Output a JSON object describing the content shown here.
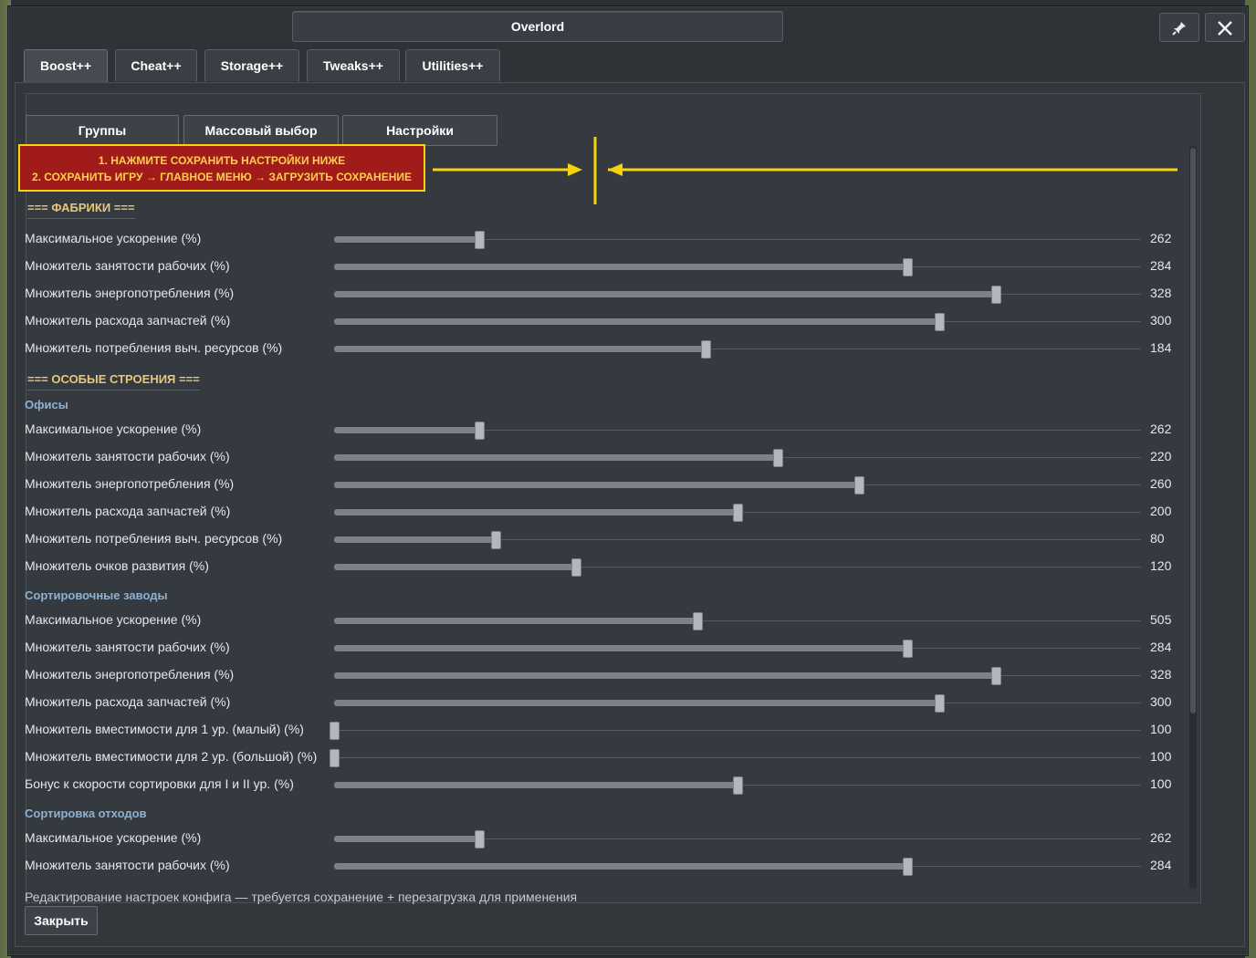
{
  "window": {
    "title": "Overlord",
    "pin_icon": "pin-icon",
    "close_icon": "close-icon"
  },
  "tabs": [
    {
      "label": "Boost++",
      "active": true
    },
    {
      "label": "Cheat++"
    },
    {
      "label": "Storage++"
    },
    {
      "label": "Tweaks++"
    },
    {
      "label": "Utilities++"
    }
  ],
  "subtabs": [
    "Группы",
    "Массовый выбор",
    "Настройки"
  ],
  "notice": {
    "line1": "1. НАЖМИТЕ СОХРАНИТЬ НАСТРОЙКИ НИЖЕ",
    "line2": "2. СОХРАНИТЬ ИГРУ → ГЛАВНОЕ МЕНЮ → ЗАГРУЗИТЬ СОХРАНЕНИЕ",
    "border_color": "#f5d40b",
    "bg_color": "#a11b1b"
  },
  "sections": {
    "factories": "=== ФАБРИКИ ===",
    "special": "=== ОСОБЫЕ СТРОЕНИЯ ==="
  },
  "groups": {
    "offices": "Офисы",
    "sorting": "Сортировочные заводы",
    "waste": "Сортировка отходов"
  },
  "sliders": {
    "factories": [
      {
        "label": "Максимальное ускорение (%)",
        "value": "262",
        "level": 0.18
      },
      {
        "label": "Множитель занятости рабочих (%)",
        "value": "284",
        "level": 0.71
      },
      {
        "label": "Множитель энергопотребления (%)",
        "value": "328",
        "level": 0.82
      },
      {
        "label": "Множитель расхода запчастей (%)",
        "value": "300",
        "level": 0.75
      },
      {
        "label": "Множитель потребления выч. ресурсов (%)",
        "value": "184",
        "level": 0.46
      }
    ],
    "offices": [
      {
        "label": "Максимальное ускорение (%)",
        "value": "262",
        "level": 0.18
      },
      {
        "label": "Множитель занятости рабочих (%)",
        "value": "220",
        "level": 0.55
      },
      {
        "label": "Множитель энергопотребления (%)",
        "value": "260",
        "level": 0.65
      },
      {
        "label": "Множитель расхода запчастей (%)",
        "value": "200",
        "level": 0.5
      },
      {
        "label": "Множитель потребления выч. ресурсов (%)",
        "value": "80",
        "level": 0.2
      },
      {
        "label": "Множитель очков развития (%)",
        "value": "120",
        "level": 0.3
      }
    ],
    "sorting": [
      {
        "label": "Максимальное ускорение (%)",
        "value": "505",
        "level": 0.45
      },
      {
        "label": "Множитель занятости рабочих (%)",
        "value": "284",
        "level": 0.71
      },
      {
        "label": "Множитель энергопотребления (%)",
        "value": "328",
        "level": 0.82
      },
      {
        "label": "Множитель расхода запчастей (%)",
        "value": "300",
        "level": 0.75
      },
      {
        "label": "Множитель вместимости для 1 ур. (малый) (%)",
        "value": "100",
        "level": 0.0
      },
      {
        "label": "Множитель вместимости для 2 ур. (большой) (%)",
        "value": "100",
        "level": 0.0
      },
      {
        "label": "Бонус к скорости сортировки для I и II ур. (%)",
        "value": "100",
        "level": 0.5
      }
    ],
    "waste": [
      {
        "label": "Максимальное ускорение (%)",
        "value": "262",
        "level": 0.18
      },
      {
        "label": "Множитель занятости рабочих (%)",
        "value": "284",
        "level": 0.71
      }
    ]
  },
  "footer": {
    "text": "Редактирование настроек конфига — требуется сохранение + перезагрузка для применения",
    "close_label": "Закрыть"
  }
}
